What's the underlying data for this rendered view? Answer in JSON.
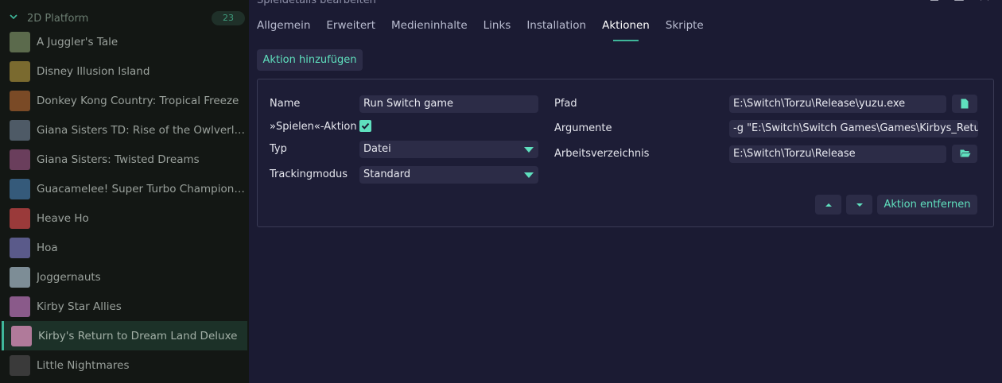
{
  "sidebar": {
    "group": {
      "title": "2D Platform",
      "count": "23"
    },
    "games": [
      {
        "name": "A Juggler's Tale",
        "thumb": "#5b6a4c"
      },
      {
        "name": "Disney Illusion Island",
        "thumb": "#7a6a2f"
      },
      {
        "name": "Donkey Kong Country: Tropical Freeze",
        "thumb": "#7a4a26"
      },
      {
        "name": "Giana Sisters TD: Rise of the Owlverlord",
        "thumb": "#4e5a66"
      },
      {
        "name": "Giana Sisters: Twisted Dreams",
        "thumb": "#6a3e5c"
      },
      {
        "name": "Guacamelee! Super Turbo Championship...",
        "thumb": "#355a7a"
      },
      {
        "name": "Heave Ho",
        "thumb": "#9a3a3a"
      },
      {
        "name": "Hoa",
        "thumb": "#5a5a8a"
      },
      {
        "name": "Joggernauts",
        "thumb": "#7d8d96"
      },
      {
        "name": "Kirby Star Allies",
        "thumb": "#8a5a8a"
      },
      {
        "name": "Kirby's Return to Dream Land Deluxe",
        "thumb": "#b07a9a"
      },
      {
        "name": "Little Nightmares",
        "thumb": "#3a3a3a"
      }
    ],
    "selected_index": 10
  },
  "dialog": {
    "title": "Spieldetails bearbeiten",
    "tabs": [
      "Allgemein",
      "Erweitert",
      "Medieninhalte",
      "Links",
      "Installation",
      "Aktionen",
      "Skripte"
    ],
    "active_tab": "Aktionen",
    "add_action_label": "Aktion hinzufügen",
    "action": {
      "name_label": "Name",
      "name_value": "Run Switch game",
      "play_action_label": "»Spielen«-Aktion",
      "play_action_checked": true,
      "type_label": "Typ",
      "type_value": "Datei",
      "tracking_label": "Trackingmodus",
      "tracking_value": "Standard",
      "path_label": "Pfad",
      "path_value": "E:\\Switch\\Torzu\\Release\\yuzu.exe",
      "args_label": "Argumente",
      "args_value": "-g \"E:\\Switch\\Switch Games\\Games\\Kirbys_Return_to_Dream_Land_Deluxe",
      "workdir_label": "Arbeitsverzeichnis",
      "workdir_value": "E:\\Switch\\Torzu\\Release",
      "remove_label": "Aktion entfernen"
    }
  },
  "colors": {
    "accent": "#5fe0be",
    "panel": "#1b1b33",
    "sidebar": "#131714"
  }
}
